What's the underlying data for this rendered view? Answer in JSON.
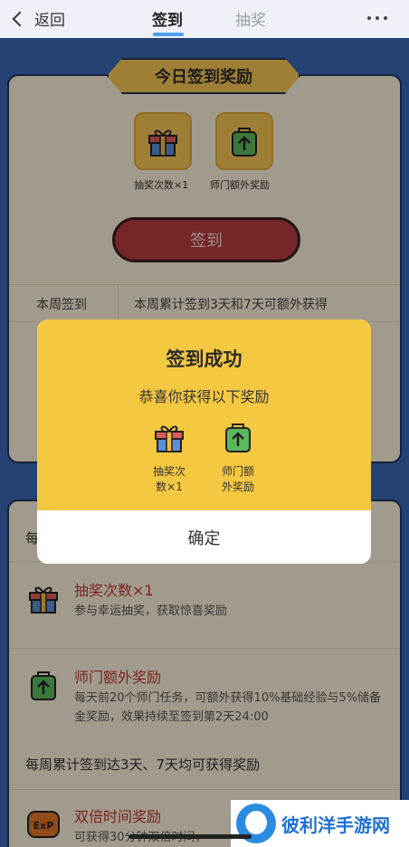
{
  "nav": {
    "back_label": "返回",
    "tabs": [
      {
        "label": "签到",
        "active": true
      },
      {
        "label": "抽奖",
        "active": false
      }
    ]
  },
  "today_panel": {
    "banner": "今日签到奖励",
    "rewards": [
      {
        "label": "抽奖次数×1",
        "icon": "gift-icon"
      },
      {
        "label": "师门额外奖励",
        "icon": "upgrade-bag-icon"
      }
    ],
    "sign_button": "签到",
    "week_label": "本周签到",
    "week_note": "本周累计签到3天和7天可额外获得"
  },
  "rewards_panel": {
    "header": "每",
    "items": [
      {
        "title": "抽奖次数×1",
        "desc": "参与幸运抽奖，获取惊喜奖励",
        "icon": "gift-icon"
      },
      {
        "title": "师门额外奖励",
        "desc": "每天前20个师门任务，可额外获得10%基础经验与5%储备金奖励，效果持续至签到第2天24:00",
        "icon": "upgrade-bag-icon"
      }
    ],
    "weekly_note": "每周累计签到达3天、7天均可获得奖励",
    "weekly_item": {
      "title": "双倍时间奖励",
      "desc": "可获得30分钟双倍时间，",
      "icon": "exp-icon"
    }
  },
  "modal": {
    "title": "签到成功",
    "subtitle": "恭喜你获得以下奖励",
    "rewards": [
      {
        "label_line1": "抽奖次",
        "label_line2": "数×1"
      },
      {
        "label_line1": "师门额",
        "label_line2": "外奖励"
      }
    ],
    "confirm": "确定"
  },
  "watermark": {
    "text": "彼利洋手游网"
  },
  "colors": {
    "page_bg": "#3a66b3",
    "panel_bg": "#f7eed9",
    "accent_yellow": "#f5c842",
    "button_red": "#b53a3e",
    "title_red": "#c0392b"
  }
}
